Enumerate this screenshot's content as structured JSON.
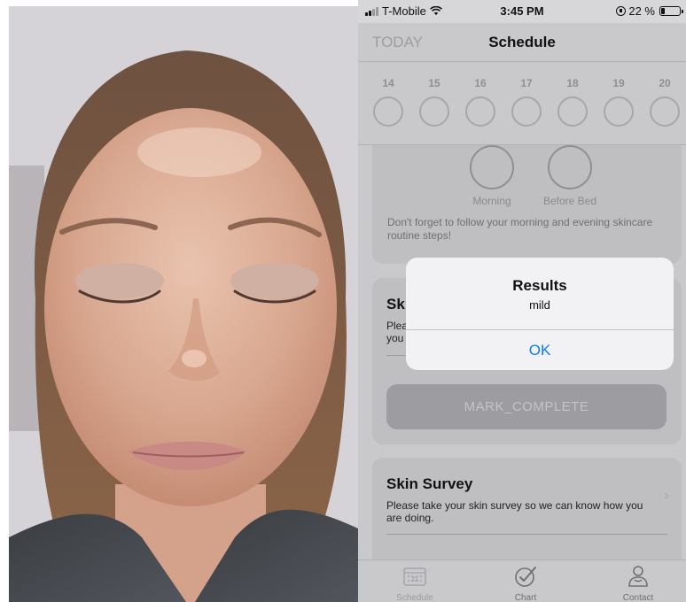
{
  "status_bar": {
    "carrier": "T-Mobile",
    "time": "3:45 PM",
    "battery": "22 %",
    "battery_level": 0.22
  },
  "nav": {
    "today_label": "TODAY",
    "title": "Schedule"
  },
  "week_days": [
    "14",
    "15",
    "16",
    "17",
    "18",
    "19",
    "20"
  ],
  "routine": {
    "morning_label": "Morning",
    "bed_label": "Before Bed",
    "message": "Don't forget to follow your morning and evening skincare routine steps!"
  },
  "survey_card_1": {
    "title": "Sk",
    "description": "Plea you",
    "mark_complete_label": "MARK_COMPLETE"
  },
  "survey_card_2": {
    "title": "Skin Survey",
    "description": "Please take your skin survey so we can know how you are doing."
  },
  "dialog": {
    "title": "Results",
    "message": "mild",
    "ok_label": "OK"
  },
  "tabs": [
    {
      "label": "Schedule",
      "icon": "calendar-icon"
    },
    {
      "label": "Chart",
      "icon": "checkmark-circle-icon"
    },
    {
      "label": "Contact",
      "icon": "person-icon"
    }
  ],
  "colors": {
    "accent": "#0a7aff",
    "overlay_gray": "#c9c9cc",
    "dialog_bg": "#f2f2f4"
  }
}
